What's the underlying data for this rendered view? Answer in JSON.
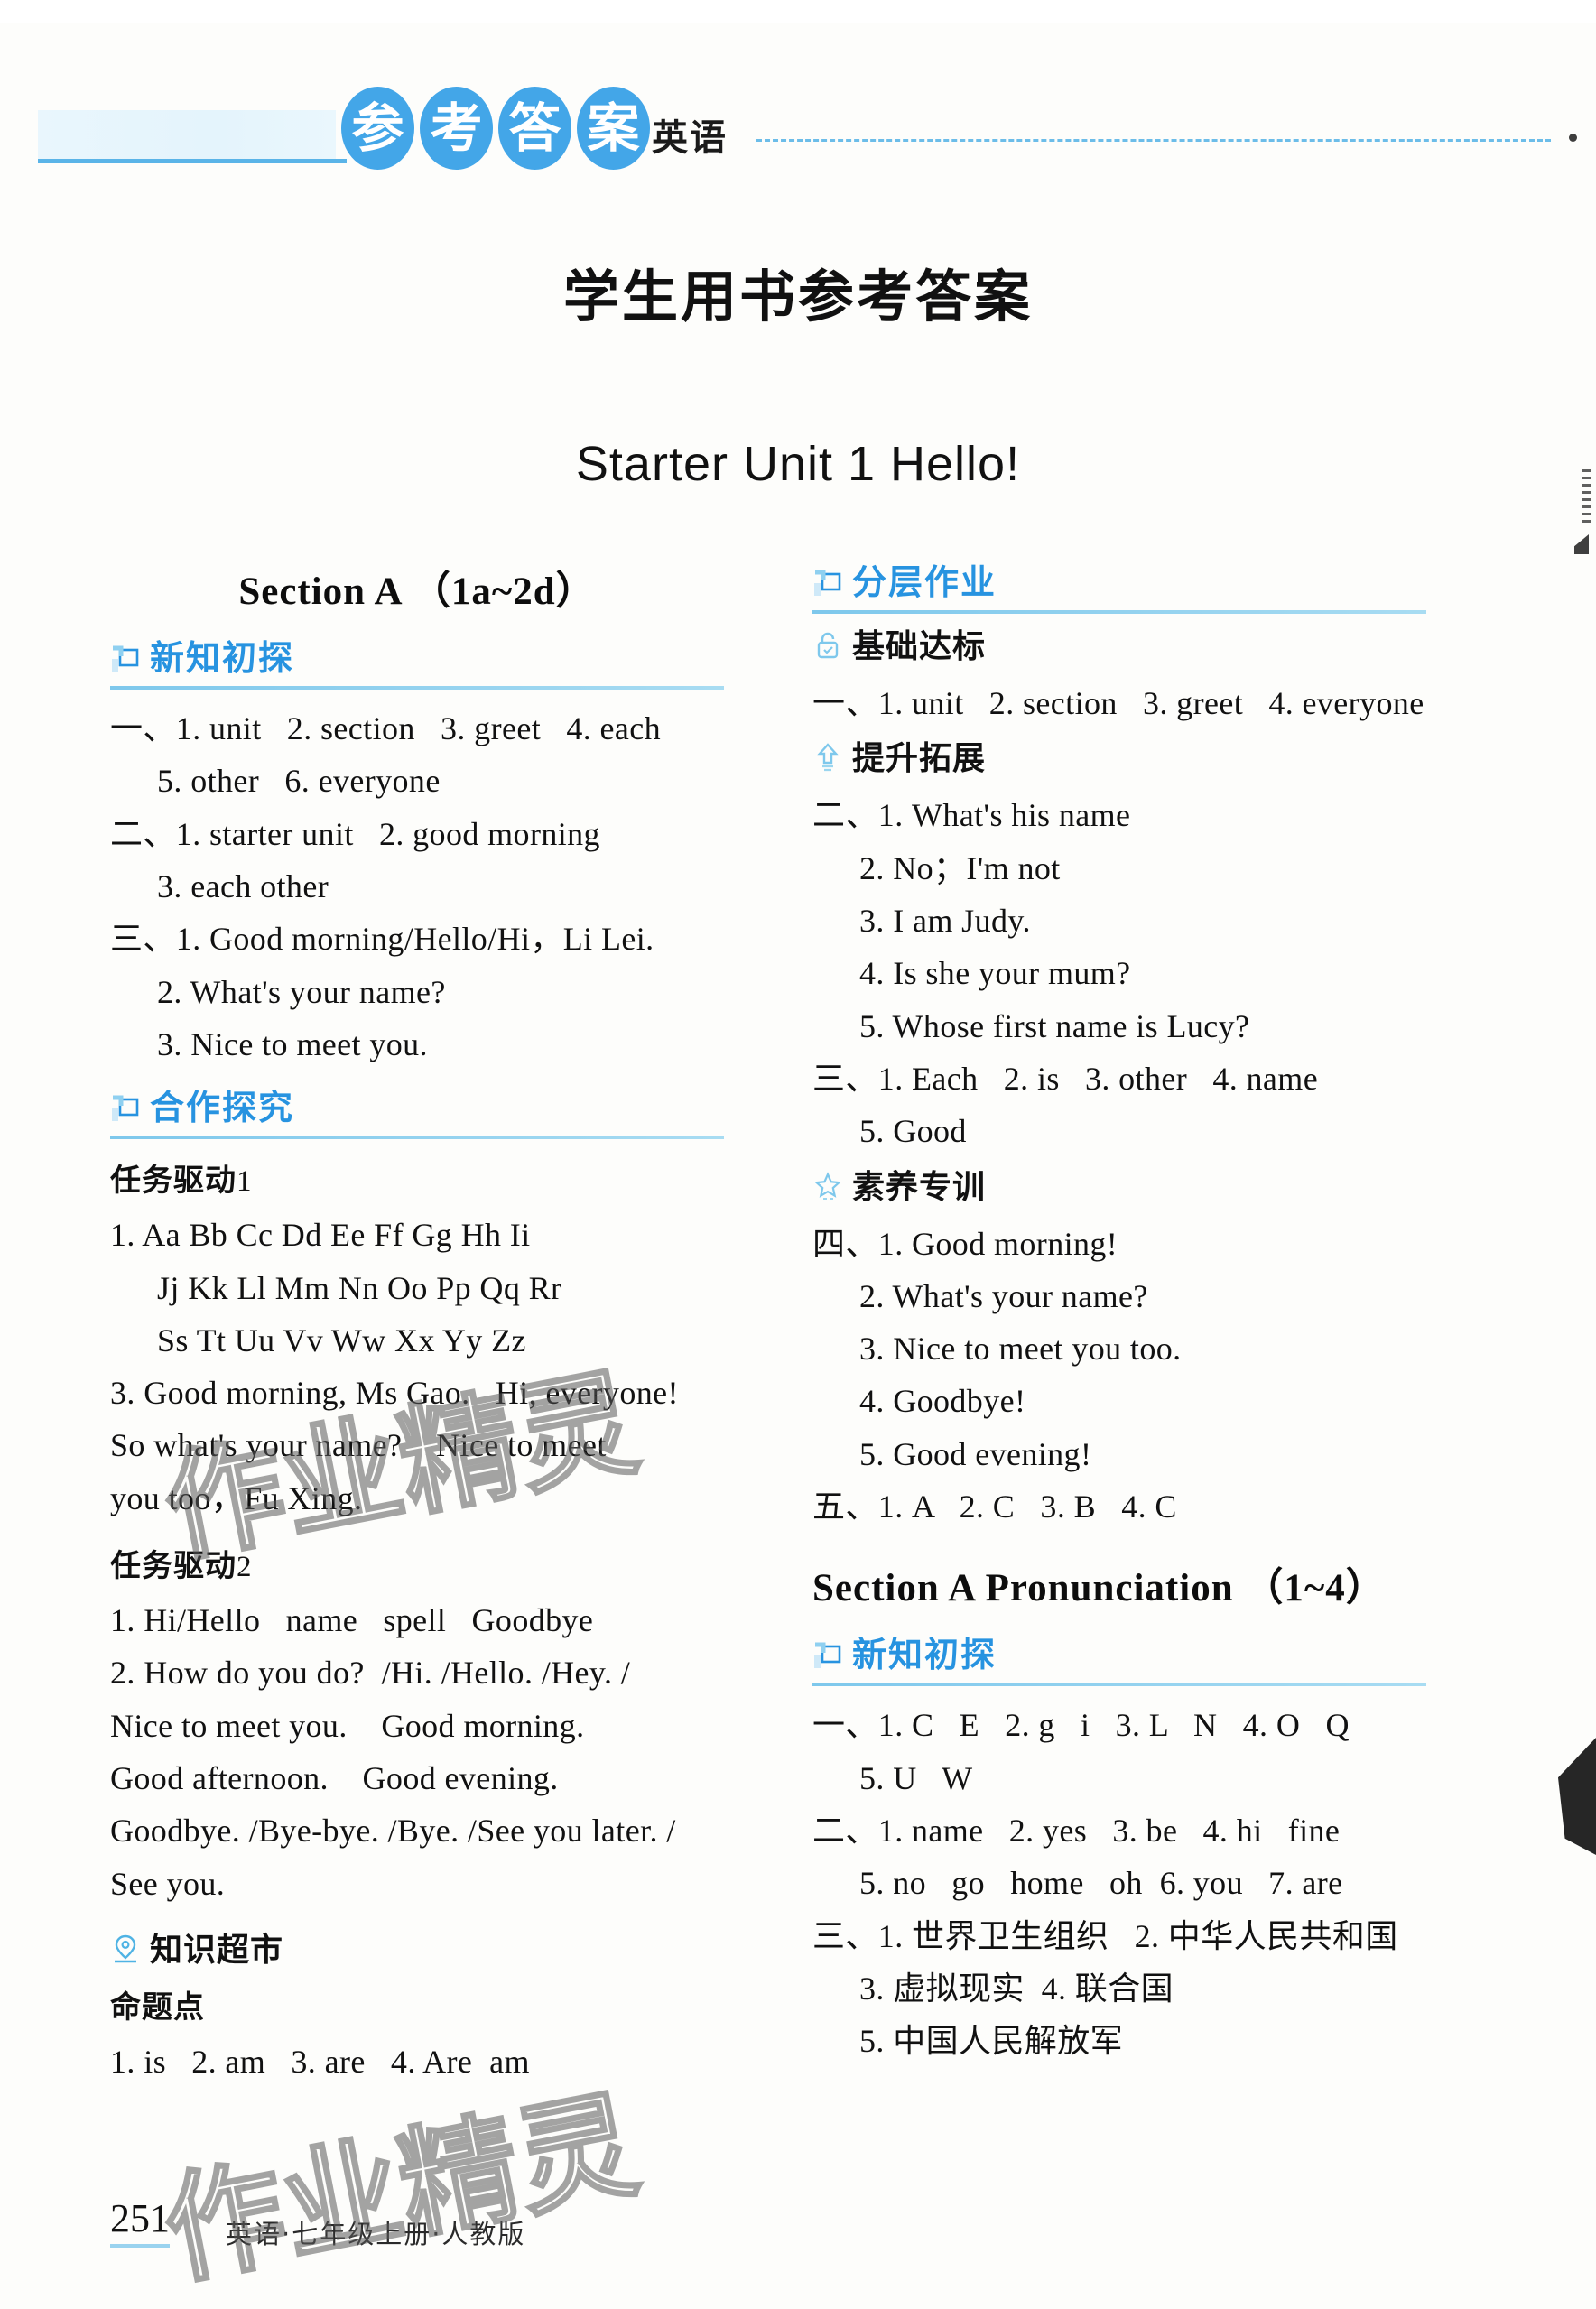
{
  "masthead": {
    "bubbles": [
      "参",
      "考",
      "答",
      "案"
    ],
    "subject": "英语",
    "accent_color": "#43a6e8",
    "rule_color": "#5ab4e8"
  },
  "doc_title": "学生用书参考答案",
  "unit_title": "Starter Unit 1   Hello!",
  "left_column": {
    "section_heading": "Section A （1a~2d）",
    "banner_1": "新知初探",
    "answers_1": [
      "一、1. unit   2. section   3. greet   4. each",
      "5. other   6. everyone",
      "二、1. starter unit   2. good morning",
      "3. each other",
      "三、1. Good morning/Hello/Hi，Li Lei.",
      "2. What's your name?",
      "3. Nice to meet you."
    ],
    "banner_2": "合作探究",
    "task_1_label": "任务驱动",
    "task_1_num": "1",
    "task_1_lines": [
      "1. Aa Bb Cc Dd Ee Ff Gg Hh Ii",
      "Jj Kk Ll Mm Nn Oo Pp Qq Rr",
      "Ss Tt Uu Vv Ww Xx Yy Zz",
      "3. Good morning, Ms Gao.   Hi, everyone!",
      "So what's your name?    Nice to meet",
      "you too，Fu Xing."
    ],
    "task_2_label": "任务驱动",
    "task_2_num": "2",
    "task_2_lines": [
      "1. Hi/Hello   name   spell   Goodbye",
      "2. How do you do?  /Hi. /Hello. /Hey. /",
      "Nice to meet you.    Good morning.",
      "Good afternoon.    Good evening.",
      "Goodbye. /Bye-bye. /Bye. /See you later. /",
      "See you."
    ],
    "subhead_market": "知识超市",
    "market_icon": "location-pin-icon",
    "point_label": "命题点",
    "point_answers": [
      "1. is   2. am   3. are   4. Are  am"
    ]
  },
  "right_column": {
    "banner_1": "分层作业",
    "subhead_1": "基础达标",
    "subhead_1_icon": "lock-icon",
    "answers_1": [
      "一、1. unit   2. section   3. greet   4. everyone"
    ],
    "subhead_2": "提升拓展",
    "subhead_2_icon": "up-arrow-icon",
    "answers_2": [
      "二、1. What's his name",
      "2. No；I'm not",
      "3. I am Judy.",
      "4. Is she your mum?",
      "5. Whose first name is Lucy?",
      "三、1. Each   2. is   3. other   4. name",
      "5. Good"
    ],
    "subhead_3": "素养专训",
    "subhead_3_icon": "star-icon",
    "answers_3": [
      "四、1. Good morning!",
      "2. What's your name?",
      "3. Nice to meet you too.",
      "4. Goodbye!",
      "5. Good evening!",
      "五、1. A   2. C   3. B   4. C"
    ],
    "section_heading": "Section A Pronunciation （1~4）",
    "banner_2": "新知初探",
    "answers_4": [
      "一、1. C   E   2. g   i   3. L   N   4. O   Q",
      "5. U   W",
      "二、1. name   2. yes   3. be   4. hi   fine",
      "5. no   go   home   oh  6. you   7. are",
      "三、1. 世界卫生组织   2. 中华人民共和国",
      "3. 虚拟现实  4. 联合国",
      "5. 中国人民解放军"
    ]
  },
  "footer": {
    "page_number": "251",
    "note": "英语·七年级上册·人教版"
  },
  "watermark": "作业精灵"
}
